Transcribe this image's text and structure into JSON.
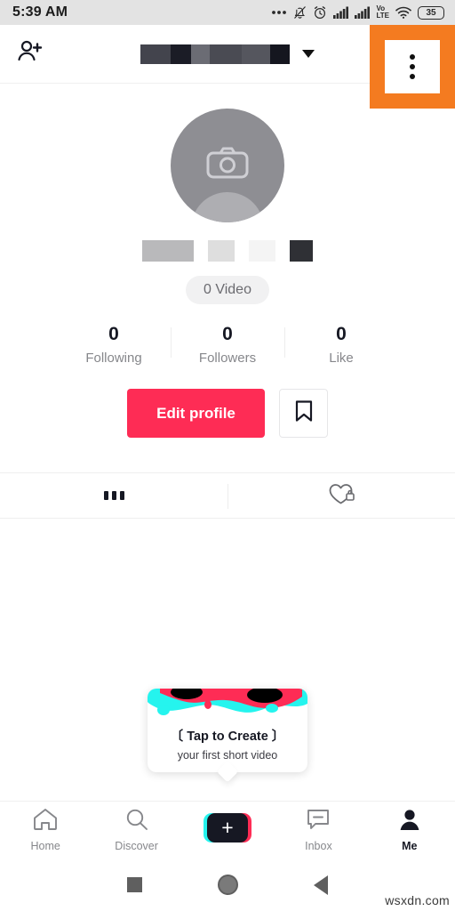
{
  "status_bar": {
    "time": "5:39 AM",
    "battery_level": "35",
    "icons": [
      "more-dots-icon",
      "bell-muted-icon",
      "alarm-clock-icon",
      "signal-bars-icon",
      "signal-bars-2-icon",
      "volte-icon",
      "wifi-icon",
      "battery-icon"
    ],
    "volte_top": "Vo",
    "volte_bottom": "LTE"
  },
  "app_bar": {
    "add_friend_icon": "add-person-icon",
    "title_redacted": true,
    "title_blocks": [
      {
        "width": 34,
        "color": "#43444d"
      },
      {
        "width": 23,
        "color": "#1b1c26"
      },
      {
        "width": 21,
        "color": "#6b6c74"
      },
      {
        "width": 36,
        "color": "#4a4b53"
      },
      {
        "width": 32,
        "color": "#55565e"
      },
      {
        "width": 22,
        "color": "#15161f"
      }
    ],
    "dropdown_icon": "chevron-down-icon",
    "kebab_icon": "more-vertical-icon",
    "highlight_color": "#f47b20"
  },
  "profile": {
    "avatar_icon": "camera-icon",
    "avatar_bg": "#8e8e93",
    "handle_redacted": true,
    "handle_blocks": [
      {
        "width": 58,
        "color": "#b9b9bb"
      },
      {
        "width": 30,
        "color": "#dedede"
      },
      {
        "width": 30,
        "color": "#f4f4f4"
      },
      {
        "width": 26,
        "color": "#2f3035"
      }
    ],
    "video_count_label": "0 Video",
    "stats": [
      {
        "value": "0",
        "label": "Following"
      },
      {
        "value": "0",
        "label": "Followers"
      },
      {
        "value": "0",
        "label": "Like"
      }
    ],
    "edit_profile_label": "Edit profile",
    "edit_profile_color": "#fe2c55",
    "bookmark_icon": "bookmark-icon"
  },
  "tabs": [
    {
      "name": "posts",
      "icon": "grid-icon",
      "active": true
    },
    {
      "name": "liked-private",
      "icon": "heart-lock-icon",
      "active": false
    }
  ],
  "tooltip": {
    "title": "〔 Tap to Create 〕",
    "subtitle": "your first short video",
    "art_colors": [
      "#25f4ee",
      "#fe2c55",
      "#000000"
    ]
  },
  "bottom_nav": [
    {
      "label": "Home",
      "icon": "home-icon",
      "active": false
    },
    {
      "label": "Discover",
      "icon": "search-icon",
      "active": false
    },
    {
      "label": "",
      "icon": "create-plus-icon",
      "active": false
    },
    {
      "label": "Inbox",
      "icon": "message-icon",
      "active": false
    },
    {
      "label": "Me",
      "icon": "person-icon",
      "active": true
    }
  ],
  "android_nav": [
    {
      "name": "recents",
      "icon": "square-icon"
    },
    {
      "name": "home",
      "icon": "circle-icon"
    },
    {
      "name": "back",
      "icon": "triangle-back-icon"
    }
  ],
  "watermark": "wsxdn.com"
}
